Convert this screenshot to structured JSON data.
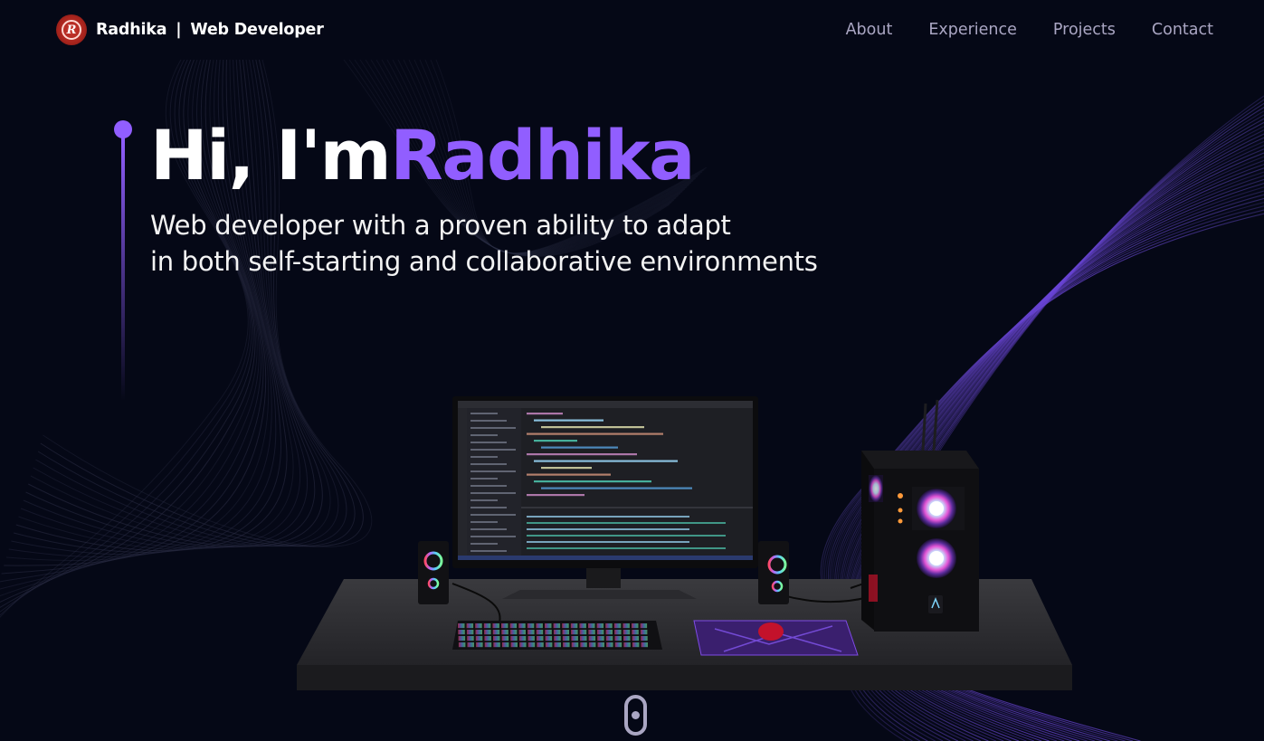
{
  "brand": {
    "name": "Radhika",
    "separator": "|",
    "role": "Web Developer",
    "logo_letter": "R",
    "logo_color": "#c9372e"
  },
  "nav": {
    "links": [
      "About",
      "Experience",
      "Projects",
      "Contact"
    ]
  },
  "hero": {
    "greeting": "Hi, I'm",
    "name": "Radhika",
    "subtitle_line1": "Web developer with a proven ability to adapt",
    "subtitle_line2": "in both self-starting and collaborative environments"
  },
  "colors": {
    "background": "#050816",
    "accent": "#915eff",
    "nav_text": "#aaa6c3"
  },
  "icons": {
    "logo": "logo-icon",
    "scroll": "mouse-scroll-icon"
  }
}
